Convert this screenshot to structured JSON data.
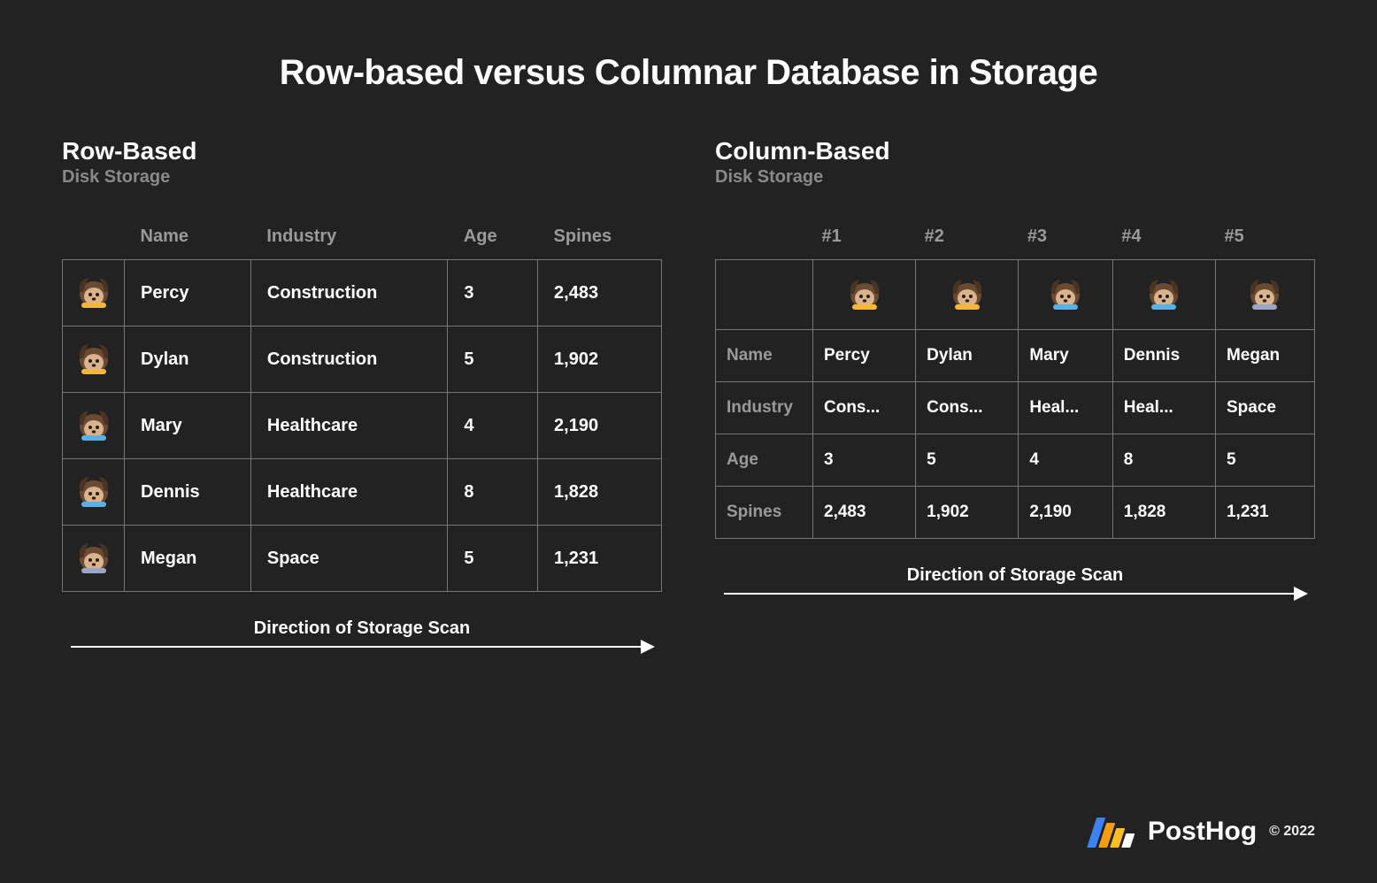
{
  "title": "Row-based versus Columnar Database in Storage",
  "row_panel": {
    "heading": "Row-Based",
    "subheading": "Disk Storage",
    "columns": [
      "Name",
      "Industry",
      "Age",
      "Spines"
    ],
    "rows": [
      {
        "avatar": "construction",
        "name": "Percy",
        "industry": "Construction",
        "age": "3",
        "spines": "2,483"
      },
      {
        "avatar": "construction",
        "name": "Dylan",
        "industry": "Construction",
        "age": "5",
        "spines": "1,902"
      },
      {
        "avatar": "healthcare",
        "name": "Mary",
        "industry": "Healthcare",
        "age": "4",
        "spines": "2,190"
      },
      {
        "avatar": "healthcare",
        "name": "Dennis",
        "industry": "Healthcare",
        "age": "8",
        "spines": "1,828"
      },
      {
        "avatar": "space",
        "name": "Megan",
        "industry": "Space",
        "age": "5",
        "spines": "1,231"
      }
    ],
    "scan_label": "Direction of Storage Scan"
  },
  "col_panel": {
    "heading": "Column-Based",
    "subheading": "Disk Storage",
    "record_ids": [
      "#1",
      "#2",
      "#3",
      "#4",
      "#5"
    ],
    "avatars": [
      "construction",
      "construction",
      "healthcare",
      "healthcare",
      "space"
    ],
    "rows": [
      {
        "label": "Name",
        "cells": [
          "Percy",
          "Dylan",
          "Mary",
          "Dennis",
          "Megan"
        ]
      },
      {
        "label": "Industry",
        "cells": [
          "Cons...",
          "Cons...",
          "Heal...",
          "Heal...",
          "Space"
        ]
      },
      {
        "label": "Age",
        "cells": [
          "3",
          "5",
          "4",
          "8",
          "5"
        ]
      },
      {
        "label": "Spines",
        "cells": [
          "2,483",
          "1,902",
          "2,190",
          "1,828",
          "1,231"
        ]
      }
    ],
    "scan_label": "Direction of Storage Scan"
  },
  "footer": {
    "brand": "PostHog",
    "copyright": "© 2022"
  },
  "chart_data": {
    "type": "table",
    "title": "Row-based versus Columnar Database in Storage",
    "records": [
      {
        "Name": "Percy",
        "Industry": "Construction",
        "Age": 3,
        "Spines": 2483
      },
      {
        "Name": "Dylan",
        "Industry": "Construction",
        "Age": 5,
        "Spines": 1902
      },
      {
        "Name": "Mary",
        "Industry": "Healthcare",
        "Age": 4,
        "Spines": 2190
      },
      {
        "Name": "Dennis",
        "Industry": "Healthcare",
        "Age": 8,
        "Spines": 1828
      },
      {
        "Name": "Megan",
        "Industry": "Space",
        "Age": 5,
        "Spines": 1231
      }
    ]
  }
}
